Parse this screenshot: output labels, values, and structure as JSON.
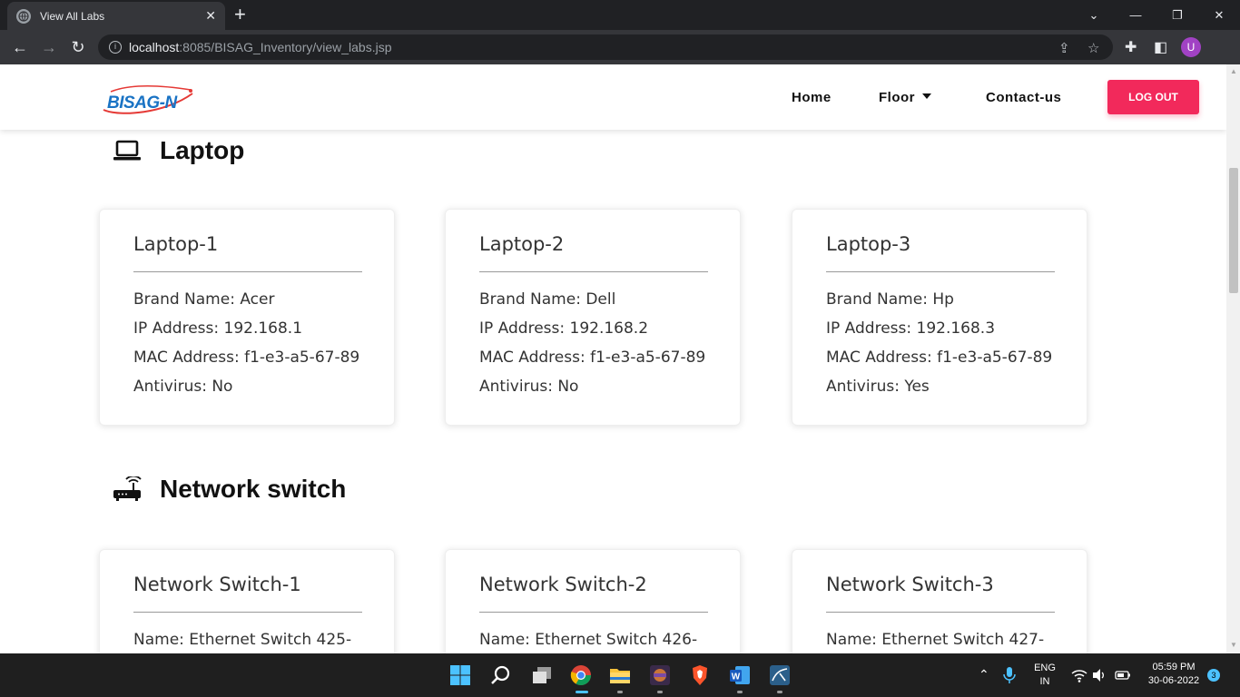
{
  "browser": {
    "tab_title": "View All Labs",
    "new_tab": "+",
    "url_host": "localhost",
    "url_rest": ":8085/BISAG_Inventory/view_labs.jsp",
    "avatar_letter": "U"
  },
  "nav": {
    "logo_text": "BISAG-N",
    "home": "Home",
    "floor": "Floor",
    "contact": "Contact-us",
    "logout": "LOG OUT"
  },
  "sections": {
    "laptop": {
      "title": "Laptop",
      "icon": "laptop-icon",
      "cards": [
        {
          "title": "Laptop-1",
          "brand": "Brand Name: Acer",
          "ip": "IP Address: 192.168.1",
          "mac": "MAC Address: f1-e3-a5-67-89",
          "antivirus": "Antivirus: No"
        },
        {
          "title": "Laptop-2",
          "brand": "Brand Name: Dell",
          "ip": "IP Address: 192.168.2",
          "mac": "MAC Address: f1-e3-a5-67-89",
          "antivirus": "Antivirus: No"
        },
        {
          "title": "Laptop-3",
          "brand": "Brand Name: Hp",
          "ip": "IP Address: 192.168.3",
          "mac": "MAC Address: f1-e3-a5-67-89",
          "antivirus": "Antivirus: Yes"
        }
      ]
    },
    "switch": {
      "title": "Network switch",
      "icon": "router-icon",
      "cards": [
        {
          "title": "Network Switch-1",
          "name": "Name: Ethernet Switch 425-"
        },
        {
          "title": "Network Switch-2",
          "name": "Name: Ethernet Switch 426-"
        },
        {
          "title": "Network Switch-3",
          "name": "Name: Ethernet Switch 427-"
        }
      ]
    }
  },
  "taskbar": {
    "lang_top": "ENG",
    "lang_bottom": "IN",
    "time": "05:59 PM",
    "date": "30-06-2022",
    "notifications": "3"
  },
  "colors": {
    "accent": "#f2295b",
    "brand_blue": "#1a73c4"
  }
}
